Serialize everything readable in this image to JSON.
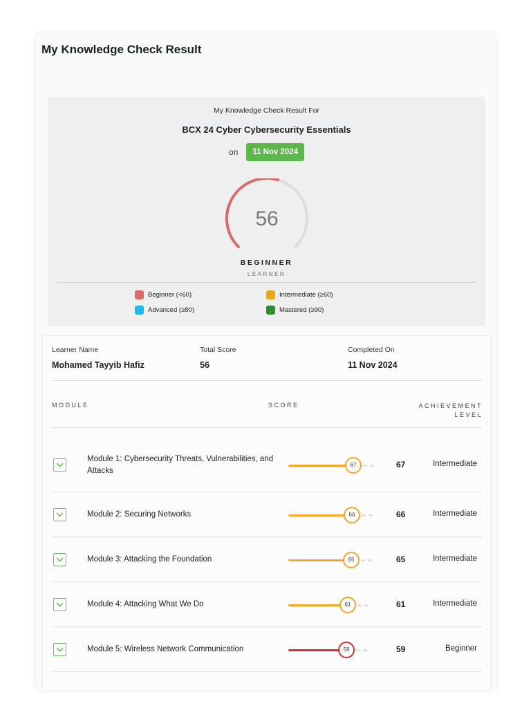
{
  "page_title": "My Knowledge Check Result",
  "summary": {
    "for_label": "My Knowledge Check Result For",
    "course_name": "BCX 24 Cyber Cybersecurity Essentials",
    "on_label": "on",
    "date": "11 Nov 2024",
    "score": "56",
    "score_fraction": 0.56,
    "level_title": "BEGINNER",
    "level_sub": "LEARNER",
    "colors": {
      "beginner": "#d96a6a",
      "track": "#dddddd",
      "date_badge": "#5db84c"
    }
  },
  "legend": [
    {
      "label": "Beginner (<60)",
      "color": "#d96a6a"
    },
    {
      "label": "Intermediate (≥60)",
      "color": "#e6a817"
    },
    {
      "label": "Advanced (≥80)",
      "color": "#1bbbe5"
    },
    {
      "label": "Mastered (≥90)",
      "color": "#2e8b2e"
    }
  ],
  "learner": {
    "name_label": "Learner Name",
    "name": "Mohamed Tayyib Hafiz",
    "total_label": "Total Score",
    "total": "56",
    "completed_label": "Completed On",
    "completed": "11 Nov 2024"
  },
  "table": {
    "headers": {
      "module": "MODULE",
      "score": "SCORE",
      "achievement": "ACHIEVEMENT LEVEL"
    },
    "rows": [
      {
        "name": "Module 1: Cybersecurity Threats, Vulnerabilities, and Attacks",
        "score": "67",
        "level": "Intermediate",
        "color": "#f5a623"
      },
      {
        "name": "Module 2: Securing Networks",
        "score": "66",
        "level": "Intermediate",
        "color": "#f5a623"
      },
      {
        "name": "Module 3: Attacking the Foundation",
        "score": "65",
        "level": "Intermediate",
        "color": "#f5a623"
      },
      {
        "name": "Module 4: Attacking What We Do",
        "score": "61",
        "level": "Intermediate",
        "color": "#f5a623"
      },
      {
        "name": "Module 5: Wireless Network Communication",
        "score": "59",
        "level": "Beginner",
        "color": "#d92b2b"
      }
    ]
  }
}
